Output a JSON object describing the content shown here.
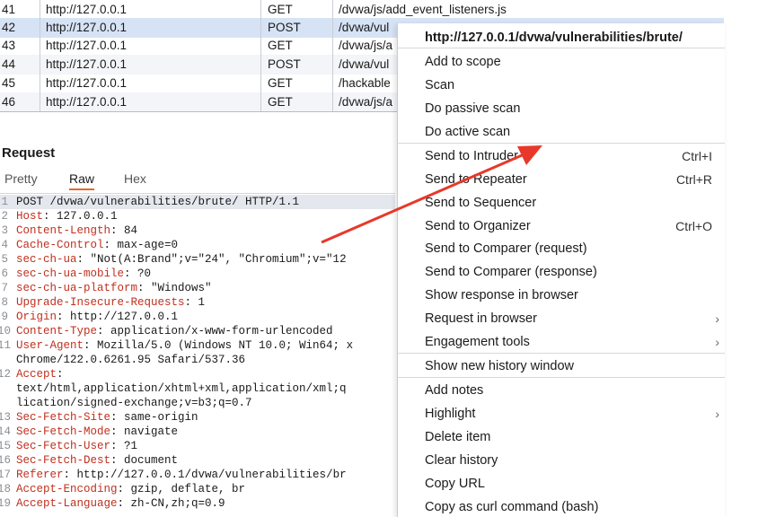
{
  "history": {
    "rows": [
      {
        "num": "41",
        "host": "http://127.0.0.1",
        "method": "GET",
        "url": "/dvwa/js/add_event_listeners.js",
        "selected": false
      },
      {
        "num": "42",
        "host": "http://127.0.0.1",
        "method": "POST",
        "url": "/dvwa/vul",
        "selected": true
      },
      {
        "num": "43",
        "host": "http://127.0.0.1",
        "method": "GET",
        "url": "/dvwa/js/a",
        "selected": false
      },
      {
        "num": "44",
        "host": "http://127.0.0.1",
        "method": "POST",
        "url": "/dvwa/vul",
        "selected": false
      },
      {
        "num": "45",
        "host": "http://127.0.0.1",
        "method": "GET",
        "url": "/hackable",
        "selected": false
      },
      {
        "num": "46",
        "host": "http://127.0.0.1",
        "method": "GET",
        "url": "/dvwa/js/a",
        "selected": false
      }
    ]
  },
  "request": {
    "title": "Request",
    "tabs": {
      "pretty": "Pretty",
      "raw": "Raw",
      "hex": "Hex"
    },
    "lines": [
      {
        "n": "1",
        "key": "",
        "text": "POST /dvwa/vulnerabilities/brute/ HTTP/1.1"
      },
      {
        "n": "2",
        "key": "Host",
        "text": ": 127.0.0.1"
      },
      {
        "n": "3",
        "key": "Content-Length",
        "text": ": 84"
      },
      {
        "n": "4",
        "key": "Cache-Control",
        "text": ": max-age=0"
      },
      {
        "n": "5",
        "key": "sec-ch-ua",
        "text": ": \"Not(A:Brand\";v=\"24\", \"Chromium\";v=\"12"
      },
      {
        "n": "6",
        "key": "sec-ch-ua-mobile",
        "text": ": ?0"
      },
      {
        "n": "7",
        "key": "sec-ch-ua-platform",
        "text": ": \"Windows\""
      },
      {
        "n": "8",
        "key": "Upgrade-Insecure-Requests",
        "text": ": 1"
      },
      {
        "n": "9",
        "key": "Origin",
        "text": ": http://127.0.0.1"
      },
      {
        "n": "10",
        "key": "Content-Type",
        "text": ": application/x-www-form-urlencoded"
      },
      {
        "n": "11",
        "key": "User-Agent",
        "text": ": Mozilla/5.0 (Windows NT 10.0; Win64; x"
      },
      {
        "n": "",
        "key": "",
        "text": "Chrome/122.0.6261.95 Safari/537.36"
      },
      {
        "n": "12",
        "key": "Accept",
        "text": ":"
      },
      {
        "n": "",
        "key": "",
        "text": "text/html,application/xhtml+xml,application/xml;q"
      },
      {
        "n": "",
        "key": "",
        "text": "lication/signed-exchange;v=b3;q=0.7"
      },
      {
        "n": "13",
        "key": "Sec-Fetch-Site",
        "text": ": same-origin"
      },
      {
        "n": "14",
        "key": "Sec-Fetch-Mode",
        "text": ": navigate"
      },
      {
        "n": "15",
        "key": "Sec-Fetch-User",
        "text": ": ?1"
      },
      {
        "n": "16",
        "key": "Sec-Fetch-Dest",
        "text": ": document"
      },
      {
        "n": "17",
        "key": "Referer",
        "text": ": http://127.0.0.1/dvwa/vulnerabilities/br"
      },
      {
        "n": "18",
        "key": "Accept-Encoding",
        "text": ": gzip, deflate, br"
      },
      {
        "n": "19",
        "key": "Accept-Language",
        "text": ": zh-CN,zh;q=0.9"
      }
    ]
  },
  "menu": {
    "items": [
      {
        "label": "http://127.0.0.1/dvwa/vulnerabilities/brute/",
        "shortcut": "",
        "submenu": false,
        "kind": "title"
      },
      {
        "label": "Add to scope",
        "shortcut": "",
        "submenu": false,
        "kind": "item"
      },
      {
        "label": "Scan",
        "shortcut": "",
        "submenu": false,
        "kind": "item"
      },
      {
        "label": "Do passive scan",
        "shortcut": "",
        "submenu": false,
        "kind": "item"
      },
      {
        "label": "Do active scan",
        "shortcut": "",
        "submenu": false,
        "kind": "item"
      },
      {
        "label": "Send to Intruder",
        "shortcut": "Ctrl+I",
        "submenu": false,
        "kind": "item"
      },
      {
        "label": "Send to Repeater",
        "shortcut": "Ctrl+R",
        "submenu": false,
        "kind": "item"
      },
      {
        "label": "Send to Sequencer",
        "shortcut": "",
        "submenu": false,
        "kind": "item"
      },
      {
        "label": "Send to Organizer",
        "shortcut": "Ctrl+O",
        "submenu": false,
        "kind": "item"
      },
      {
        "label": "Send to Comparer (request)",
        "shortcut": "",
        "submenu": false,
        "kind": "item"
      },
      {
        "label": "Send to Comparer (response)",
        "shortcut": "",
        "submenu": false,
        "kind": "item"
      },
      {
        "label": "Show response in browser",
        "shortcut": "",
        "submenu": false,
        "kind": "item"
      },
      {
        "label": "Request in browser",
        "shortcut": "",
        "submenu": true,
        "kind": "item"
      },
      {
        "label": "Engagement tools",
        "shortcut": "",
        "submenu": true,
        "kind": "item"
      },
      {
        "label": "Show new history window",
        "shortcut": "",
        "submenu": false,
        "kind": "item"
      },
      {
        "label": "Add notes",
        "shortcut": "",
        "submenu": false,
        "kind": "item"
      },
      {
        "label": "Highlight",
        "shortcut": "",
        "submenu": true,
        "kind": "item"
      },
      {
        "label": "Delete item",
        "shortcut": "",
        "submenu": false,
        "kind": "item"
      },
      {
        "label": "Clear history",
        "shortcut": "",
        "submenu": false,
        "kind": "item"
      },
      {
        "label": "Copy URL",
        "shortcut": "",
        "submenu": false,
        "kind": "item"
      },
      {
        "label": "Copy as curl command (bash)",
        "shortcut": "",
        "submenu": false,
        "kind": "item"
      }
    ]
  },
  "annotation": {
    "arrow_color": "#e8382a"
  },
  "icons": {
    "submenu": "chevron-right-icon"
  }
}
